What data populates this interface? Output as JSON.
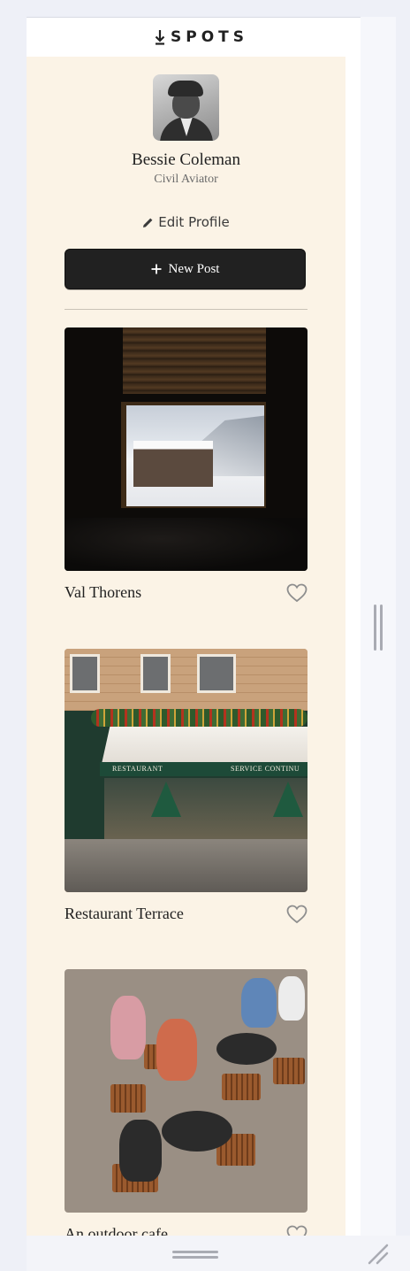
{
  "app": {
    "logo_text": "SPOTS",
    "logo_icon": "download-arrow-icon"
  },
  "profile": {
    "name": "Bessie Coleman",
    "description": "Civil Aviator",
    "edit_label": "Edit Profile",
    "new_post_label": "New Post"
  },
  "cards": [
    {
      "title": "Val Thorens",
      "liked": false,
      "image_alt": "Val Thorens"
    },
    {
      "title": "Restaurant Terrace",
      "liked": false,
      "image_alt": "Restaurant Terrace",
      "signs": [
        "RESTAURANT",
        "SERVICE CONTINU"
      ]
    },
    {
      "title": "An outdoor cafe",
      "liked": false,
      "image_alt": "An outdoor cafe"
    }
  ],
  "colors": {
    "background": "#fbf3e6",
    "text": "#212121",
    "button": "#212121",
    "muted": "#6b6b6b"
  }
}
